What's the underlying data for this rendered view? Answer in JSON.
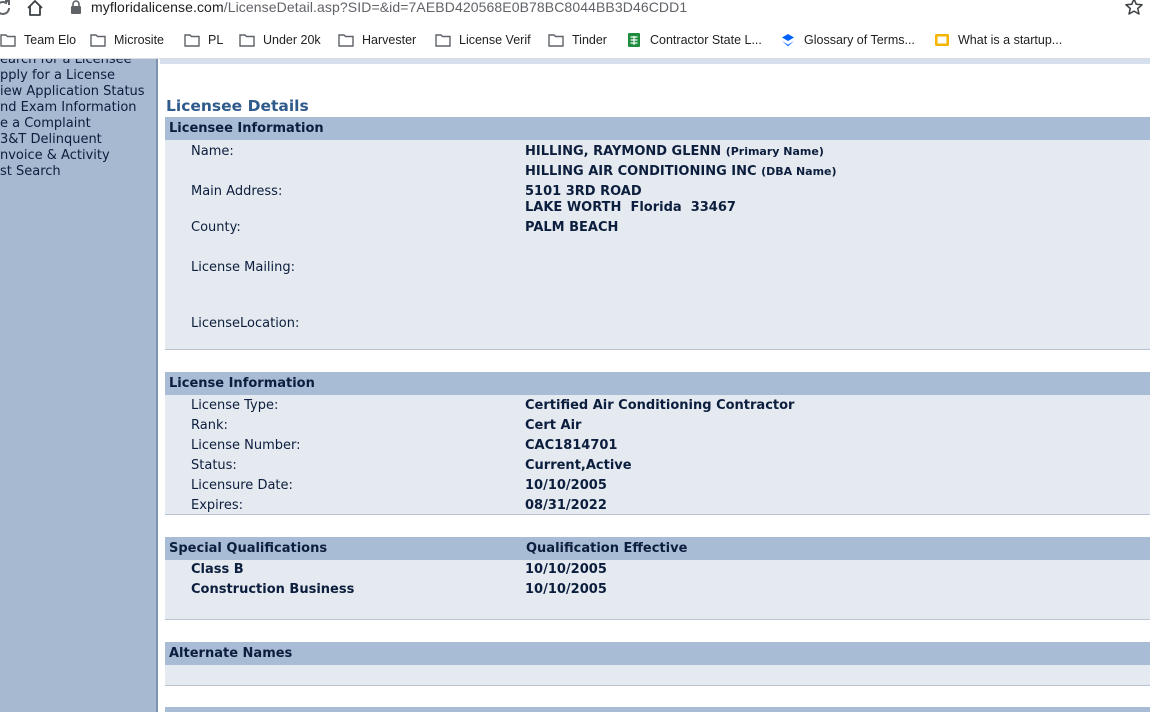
{
  "browser": {
    "url_host": "myfloridalicense.com",
    "url_path": "/LicenseDetail.asp?SID=&id=7AEBD420568E0B78BC8044BB3D46CDD1",
    "bookmarks": [
      {
        "label": "Team Elo",
        "icon": "folder-icon"
      },
      {
        "label": "Microsite",
        "icon": "folder-icon"
      },
      {
        "label": "PL",
        "icon": "folder-icon"
      },
      {
        "label": "Under 20k",
        "icon": "folder-icon"
      },
      {
        "label": "Harvester",
        "icon": "folder-icon"
      },
      {
        "label": "License Verif",
        "icon": "folder-icon"
      },
      {
        "label": "Tinder",
        "icon": "folder-icon"
      },
      {
        "label": "Contractor State L...",
        "icon": "sheets-icon"
      },
      {
        "label": "Glossary of Terms...",
        "icon": "dropbox-icon"
      },
      {
        "label": "What is a startup...",
        "icon": "slides-icon"
      }
    ]
  },
  "sidebar": {
    "items": [
      {
        "label": "earch for a Licensee"
      },
      {
        "label": "pply for a License"
      },
      {
        "label": "iew Application Status"
      },
      {
        "label": "nd Exam Information"
      },
      {
        "label": "e a Complaint"
      },
      {
        "label": "3&T Delinquent"
      },
      {
        "label": "nvoice & Activity"
      },
      {
        "label": "st Search"
      }
    ]
  },
  "page": {
    "title": "Licensee Details"
  },
  "licensee": {
    "heading": "Licensee Information",
    "name_label": "Name:",
    "primary_name": "HILLING, RAYMOND GLENN",
    "primary_note": "(Primary Name)",
    "dba_name": "HILLING AIR CONDITIONING INC",
    "dba_note": "(DBA Name)",
    "address_label": "Main Address:",
    "address_line1": "5101 3RD ROAD",
    "address_line2": "LAKE WORTH  Florida  33467",
    "county_label": "County:",
    "county": "PALM BEACH",
    "mailing_label": "License Mailing:",
    "location_label": "LicenseLocation:"
  },
  "license": {
    "heading": "License Information",
    "rows": [
      {
        "label": "License Type:",
        "value": "Certified Air Conditioning Contractor"
      },
      {
        "label": "Rank:",
        "value": "Cert Air"
      },
      {
        "label": "License Number:",
        "value": "CAC1814701"
      },
      {
        "label": "Status:",
        "value": "Current,Active"
      },
      {
        "label": "Licensure Date:",
        "value": "10/10/2005"
      },
      {
        "label": "Expires:",
        "value": "08/31/2022"
      }
    ]
  },
  "qualifications": {
    "heading": "Special Qualifications",
    "effective_heading": "Qualification Effective",
    "rows": [
      {
        "name": "Class B",
        "date": "10/10/2005"
      },
      {
        "name": "Construction Business",
        "date": "10/10/2005"
      }
    ]
  },
  "alternate": {
    "heading": "Alternate Names"
  }
}
